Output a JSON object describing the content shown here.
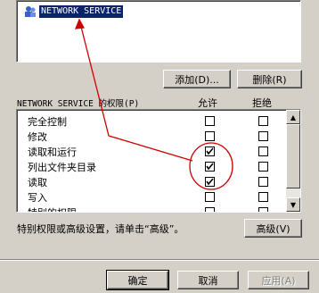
{
  "users_list": {
    "selected_item": "NETWORK SERVICE"
  },
  "buttons": {
    "add": "添加(D)...",
    "remove": "删除(R)",
    "advanced": "高级(V)",
    "ok": "确定",
    "cancel": "取消",
    "apply": "应用(A)"
  },
  "permissions": {
    "header_label": "NETWORK SERVICE 的权限(P)",
    "allow_header": "允许",
    "deny_header": "拒绝",
    "rows": [
      {
        "name": "完全控制",
        "allow": false,
        "deny": false
      },
      {
        "name": "修改",
        "allow": false,
        "deny": false
      },
      {
        "name": "读取和运行",
        "allow": true,
        "deny": false
      },
      {
        "name": "列出文件夹目录",
        "allow": true,
        "deny": false
      },
      {
        "name": "读取",
        "allow": true,
        "deny": false
      },
      {
        "name": "写入",
        "allow": false,
        "deny": false
      },
      {
        "name": "特别的权限",
        "allow": false,
        "deny": false
      }
    ]
  },
  "advanced_hint": "特别权限或高级设置，请单击“高级”。",
  "annotation_color": "#cc0000"
}
